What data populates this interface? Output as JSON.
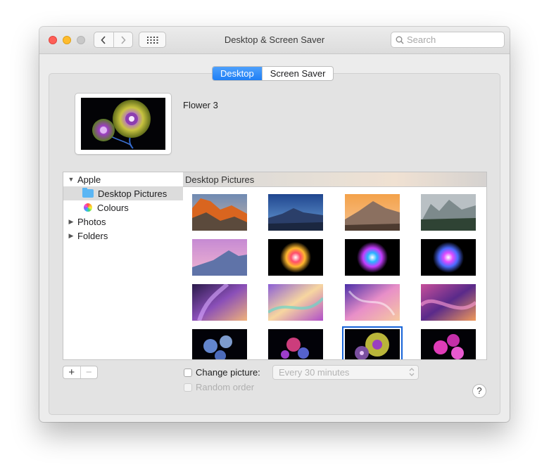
{
  "window": {
    "title": "Desktop & Screen Saver"
  },
  "search": {
    "placeholder": "Search"
  },
  "tabs": [
    {
      "label": "Desktop",
      "active": true
    },
    {
      "label": "Screen Saver",
      "active": false
    }
  ],
  "current_wallpaper": {
    "name": "Flower 3"
  },
  "sidebar": {
    "apple": {
      "label": "Apple",
      "expanded": true
    },
    "desktop_pictures": {
      "label": "Desktop Pictures",
      "selected": true
    },
    "colours": {
      "label": "Colours"
    },
    "photos": {
      "label": "Photos",
      "expanded": false
    },
    "folders": {
      "label": "Folders",
      "expanded": false
    }
  },
  "gallery": {
    "header": "Desktop Pictures",
    "selected_index": 14
  },
  "controls": {
    "add_label": "+",
    "remove_label": "−",
    "change_picture_label": "Change picture:",
    "change_picture_checked": false,
    "interval_value": "Every 30 minutes",
    "random_order_label": "Random order",
    "random_order_checked": false,
    "help_label": "?"
  },
  "colors": {
    "accent": "#1f7ff5",
    "close": "#fe5f57",
    "minimize": "#febc2e"
  }
}
